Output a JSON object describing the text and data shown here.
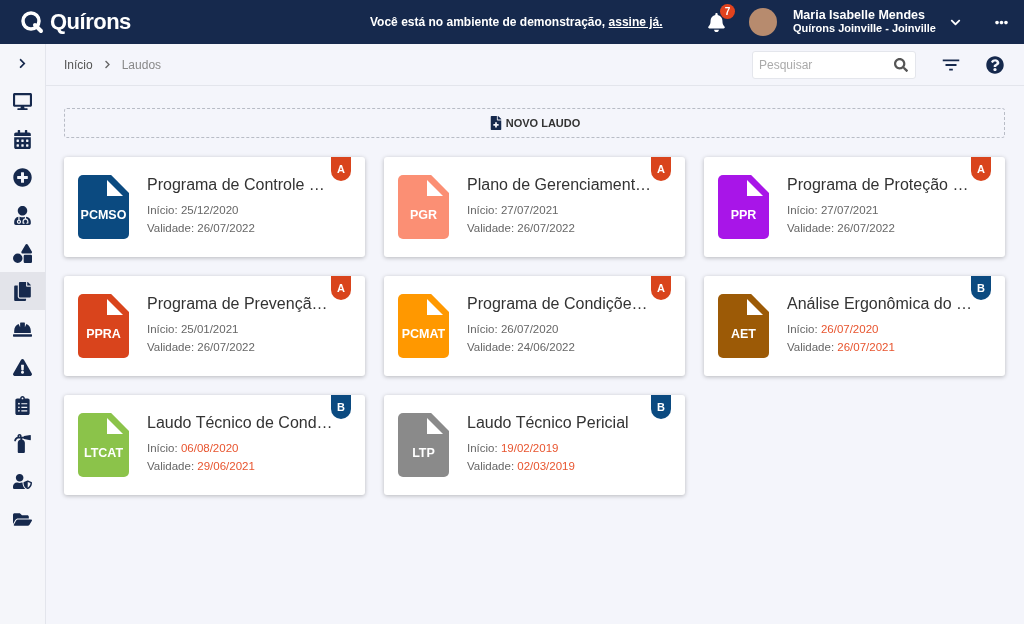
{
  "header": {
    "brand": "Quírons",
    "notice": "Você está no ambiente de demonstração,",
    "notice_link": "assine já.",
    "notifications": "7",
    "user_name": "Maria Isabelle Mendes",
    "user_unit": "Quírons Joinville - Joinville"
  },
  "sidebar": {
    "items": [
      {
        "selected": false
      },
      {
        "selected": false
      },
      {
        "selected": false
      },
      {
        "selected": false
      },
      {
        "selected": false
      },
      {
        "selected": true
      },
      {
        "selected": false
      },
      {
        "selected": false
      },
      {
        "selected": false
      },
      {
        "selected": false
      },
      {
        "selected": false
      },
      {
        "selected": false
      }
    ]
  },
  "breadcrumb": [
    "Início",
    "Laudos"
  ],
  "search": {
    "placeholder": "Pesquisar"
  },
  "new_button": "NOVO LAUDO",
  "cards": [
    {
      "title": "Programa de Controle …",
      "abbr": "PCMSO",
      "color": "#0b4a80",
      "badge": {
        "label": "A",
        "color": "#d9441c"
      },
      "start_label": "Início:",
      "start": "25/12/2020",
      "validity_label": "Validade:",
      "validity": "26/07/2022",
      "expired": false
    },
    {
      "title": "Plano de Gerenciament…",
      "abbr": "PGR",
      "color": "#fb8f74",
      "badge": {
        "label": "A",
        "color": "#d9441c"
      },
      "start_label": "Início:",
      "start": "27/07/2021",
      "validity_label": "Validade:",
      "validity": "26/07/2022",
      "expired": false
    },
    {
      "title": "Programa de Proteção …",
      "abbr": "PPR",
      "color": "#a815e8",
      "badge": {
        "label": "A",
        "color": "#d9441c"
      },
      "start_label": "Início:",
      "start": "27/07/2021",
      "validity_label": "Validade:",
      "validity": "26/07/2022",
      "expired": false
    },
    {
      "title": "Programa de Prevençã…",
      "abbr": "PPRA",
      "color": "#d9441c",
      "badge": {
        "label": "A",
        "color": "#d9441c"
      },
      "start_label": "Início:",
      "start": "25/01/2021",
      "validity_label": "Validade:",
      "validity": "26/07/2022",
      "expired": false
    },
    {
      "title": "Programa de Condiçõe…",
      "abbr": "PCMAT",
      "color": "#ff9800",
      "badge": {
        "label": "A",
        "color": "#d9441c"
      },
      "start_label": "Início:",
      "start": "26/07/2020",
      "validity_label": "Validade:",
      "validity": "24/06/2022",
      "expired": false
    },
    {
      "title": "Análise Ergonômica do …",
      "abbr": "AET",
      "color": "#9c5a06",
      "badge": {
        "label": "B",
        "color": "#0b4a80"
      },
      "start_label": "Início:",
      "start": "26/07/2020",
      "validity_label": "Validade:",
      "validity": "26/07/2021",
      "expired": true
    },
    {
      "title": "Laudo Técnico de Cond…",
      "abbr": "LTCAT",
      "color": "#8bc34a",
      "badge": {
        "label": "B",
        "color": "#0b4a80"
      },
      "start_label": "Início:",
      "start": "06/08/2020",
      "validity_label": "Validade:",
      "validity": "29/06/2021",
      "expired": true
    },
    {
      "title": "Laudo Técnico Pericial",
      "abbr": "LTP",
      "color": "#8a8a8a",
      "badge": {
        "label": "B",
        "color": "#0b4a80"
      },
      "start_label": "Início:",
      "start": "19/02/2019",
      "validity_label": "Validade:",
      "validity": "02/03/2019",
      "expired": true
    }
  ]
}
